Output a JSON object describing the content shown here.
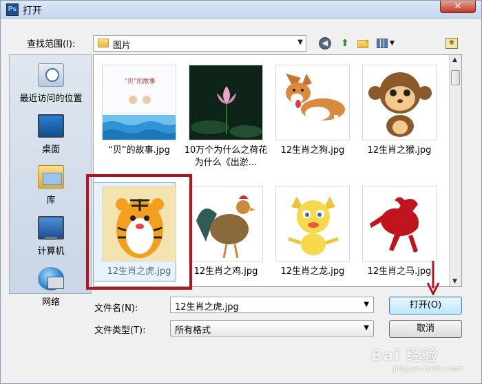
{
  "window": {
    "title": "打开",
    "app_logo": "Ps",
    "close_glyph": "✕"
  },
  "toolbar": {
    "lookin_label": "查找范围(I):",
    "lookin_value": "图片",
    "icons": [
      "back-icon",
      "up-folder-icon",
      "new-folder-icon",
      "view-menu-icon",
      "favorites-icon"
    ]
  },
  "places": [
    {
      "label": "最近访问的位置",
      "icon": "recent-places-icon"
    },
    {
      "label": "桌面",
      "icon": "desktop-icon"
    },
    {
      "label": "库",
      "icon": "library-icon"
    },
    {
      "label": "计算机",
      "icon": "computer-icon"
    },
    {
      "label": "网络",
      "icon": "network-icon"
    }
  ],
  "files": [
    {
      "name": "“贝”的故事.jpg",
      "thumb_text": "“贝”的故事"
    },
    {
      "name": "10万个为什么之荷花为什么《出淤..."
    },
    {
      "name": "12生肖之狗.jpg"
    },
    {
      "name": "12生肖之猴.jpg"
    },
    {
      "name": "12生肖之虎.jpg",
      "selected": true
    },
    {
      "name": "12生肖之鸡.jpg"
    },
    {
      "name": "12生肖之龙.jpg"
    },
    {
      "name": "12生肖之马.jpg"
    }
  ],
  "form": {
    "filename_label": "文件名(N):",
    "filename_value": "12生肖之虎.jpg",
    "filetype_label": "文件类型(T):",
    "filetype_value": "所有格式"
  },
  "buttons": {
    "open": "打开(O)",
    "cancel": "取消"
  },
  "watermark": {
    "main": "Bai 经验",
    "sub": "jingyan.baidu.com"
  },
  "colors": {
    "highlight_box": "#b3141e",
    "arrow": "#b3141e",
    "selection": "#cce2fa"
  }
}
